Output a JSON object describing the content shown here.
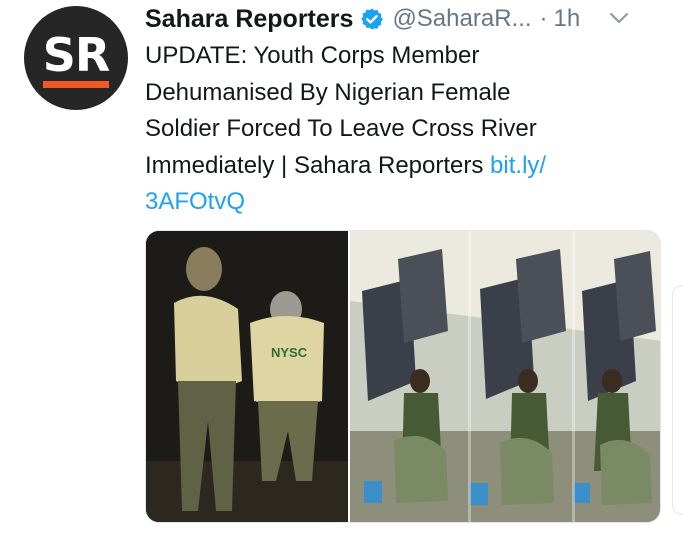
{
  "tweet": {
    "author_name": "Sahara Reporters",
    "author_handle": "@SaharaR...",
    "separator": "·",
    "time_ago": "1h",
    "avatar_initials": "SR",
    "text_lines": [
      "UPDATE: Youth Corps Member",
      "Dehumanised By Nigerian Female",
      "Soldier Forced To Leave Cross River",
      "Immediately | Sahara Reporters "
    ],
    "link_part1": "bit.ly/",
    "link_part2": "3AFOtvQ",
    "uniform_label": "NYSC"
  },
  "icons": {
    "verified": "verified-badge-icon",
    "menu": "chevron-down-icon"
  },
  "colors": {
    "link": "#1da1f2",
    "verified": "#1da1f2",
    "secondary_text": "#657786",
    "brand_bar": "#f05a22",
    "avatar_bg": "#262626"
  }
}
